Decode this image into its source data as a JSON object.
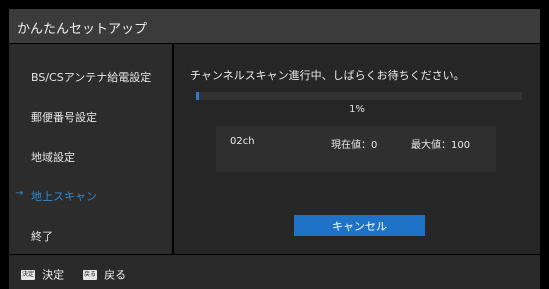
{
  "window": {
    "title": "かんたんセットアップ"
  },
  "sidebar": {
    "items": [
      {
        "label": "BS/CSアンテナ給電設定",
        "active": false
      },
      {
        "label": "郵便番号設定",
        "active": false
      },
      {
        "label": "地域設定",
        "active": false
      },
      {
        "label": "地上スキャン",
        "active": true,
        "icon": "arrow-right-icon"
      },
      {
        "label": "終了",
        "active": false
      }
    ]
  },
  "main": {
    "message": "チャンネルスキャン進行中、しばらくお待ちください。",
    "progress": {
      "value": 0.01,
      "text": "1%"
    },
    "scan": {
      "channel": "02ch",
      "current_label": "現在値：0",
      "max_label": "最大値：100"
    },
    "cancel_label": "キャンセル"
  },
  "footer": {
    "items": [
      {
        "key": "決定",
        "label": "決定"
      },
      {
        "key": "戻る",
        "label": "戻る"
      }
    ]
  },
  "colors": {
    "accent": "#1f73c6",
    "active_text": "#2c8ad6"
  }
}
